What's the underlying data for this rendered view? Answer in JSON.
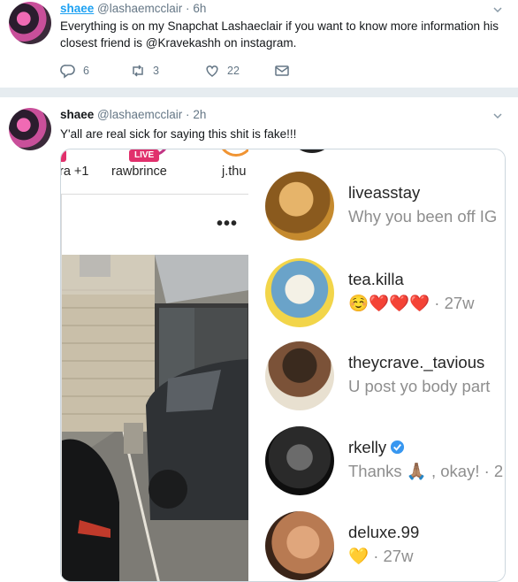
{
  "tweets": [
    {
      "name": "shaee",
      "handle": "@lashaemcclair",
      "separator": "·",
      "time": "6h",
      "text": "Everything is on my Snapchat Lashaeclair if you want to know more information his closest friend is @Kravekashh on instagram.",
      "replies": "6",
      "retweets": "3",
      "likes": "22"
    },
    {
      "name": "shaee",
      "handle": "@lashaemcclair",
      "separator": "·",
      "time": "2h",
      "text": "Y'all are real sick for saying this shit is fake!!!"
    }
  ],
  "media": {
    "stories": [
      {
        "label": "ra +1",
        "live": ""
      },
      {
        "label": "rawbrince",
        "live": "LIVE"
      },
      {
        "label": "j.thu",
        "live": ""
      }
    ],
    "post_menu": "•••",
    "dms": [
      {
        "username": "liveasstay",
        "message": "Why you been off IG",
        "avatar_color": "#c58a2e"
      },
      {
        "username": "tea.killa",
        "message": "☺️❤️❤️❤️",
        "time": "· 27w",
        "avatar_color": "#6aa3c9"
      },
      {
        "username": "theycrave._tavious",
        "message": "U post yo body part",
        "avatar_color": "#e8e0d0"
      },
      {
        "username": "rkelly",
        "message": "Thanks 🙏🏽 , okay! · 2",
        "verified": true,
        "avatar_color": "#2a2a2a"
      },
      {
        "username": "deluxe.99",
        "message": "💛",
        "time": "· 27w",
        "avatar_color": "#b87a52"
      }
    ]
  },
  "colors": {
    "link": "#1da1f2",
    "muted": "#657786",
    "live_badge": "#e1306c",
    "verified": "#3897f0"
  }
}
